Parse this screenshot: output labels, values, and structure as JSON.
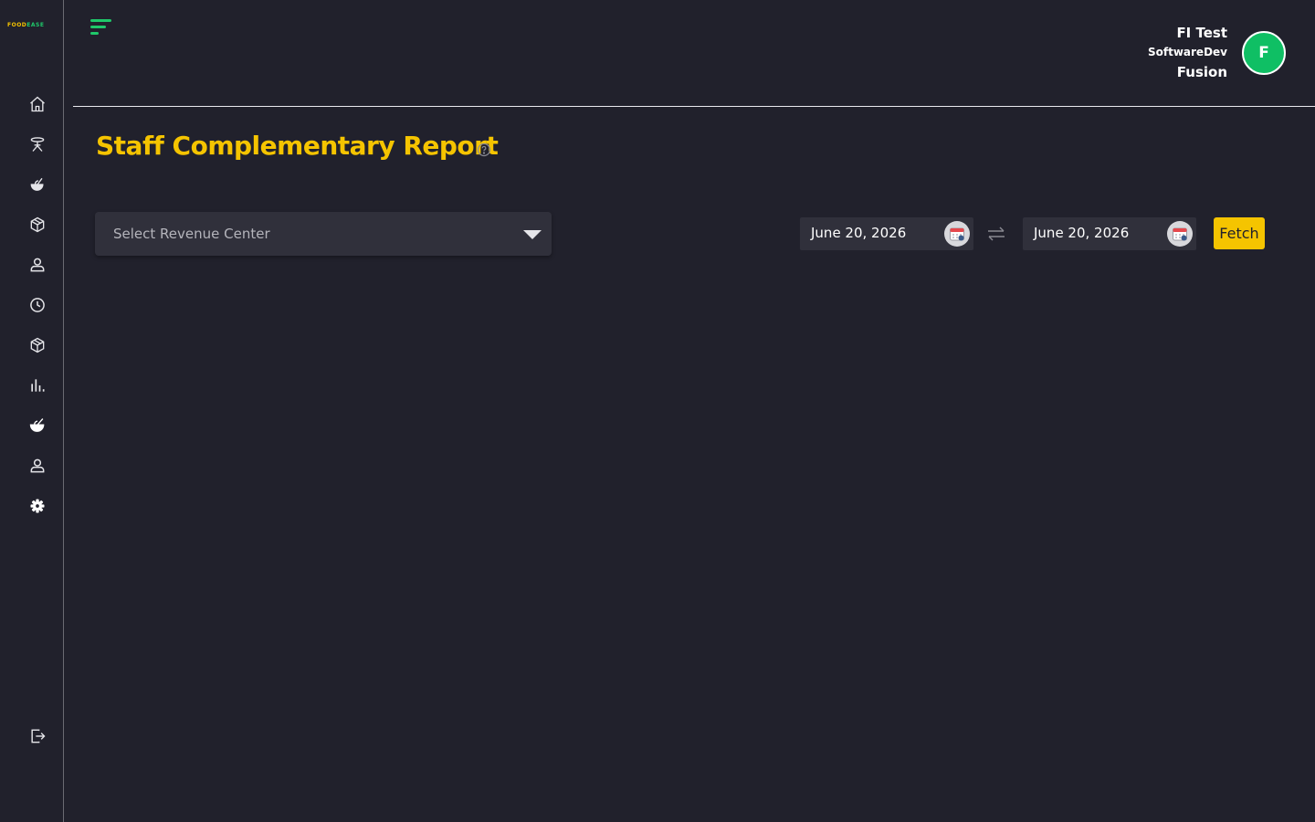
{
  "app": {
    "logo_part1": "FOOD",
    "logo_part2": "EASE",
    "brand_yellow": "#f5c400",
    "brand_green": "#1fc86a"
  },
  "sidebar": {
    "items": [
      {
        "icon": "home-icon"
      },
      {
        "icon": "table-icon"
      },
      {
        "icon": "food-icon"
      },
      {
        "icon": "box-icon"
      },
      {
        "icon": "user-icon"
      },
      {
        "icon": "clock-icon"
      },
      {
        "icon": "inventory-icon"
      },
      {
        "icon": "bar-chart-icon"
      },
      {
        "icon": "food-filled-icon"
      },
      {
        "icon": "staff-icon"
      },
      {
        "icon": "settings-icon"
      }
    ],
    "logout_icon": "logout-icon"
  },
  "header": {
    "user_name": "FI Test",
    "user_role": "SoftwareDev",
    "user_org": "Fusion",
    "avatar_initial": "F"
  },
  "page": {
    "title": "Staff Complementary Report",
    "revenue_center_placeholder": "Select Revenue Center",
    "start_date": "June 20, 2026",
    "end_date": "June 20, 2026",
    "fetch_label": "Fetch"
  }
}
